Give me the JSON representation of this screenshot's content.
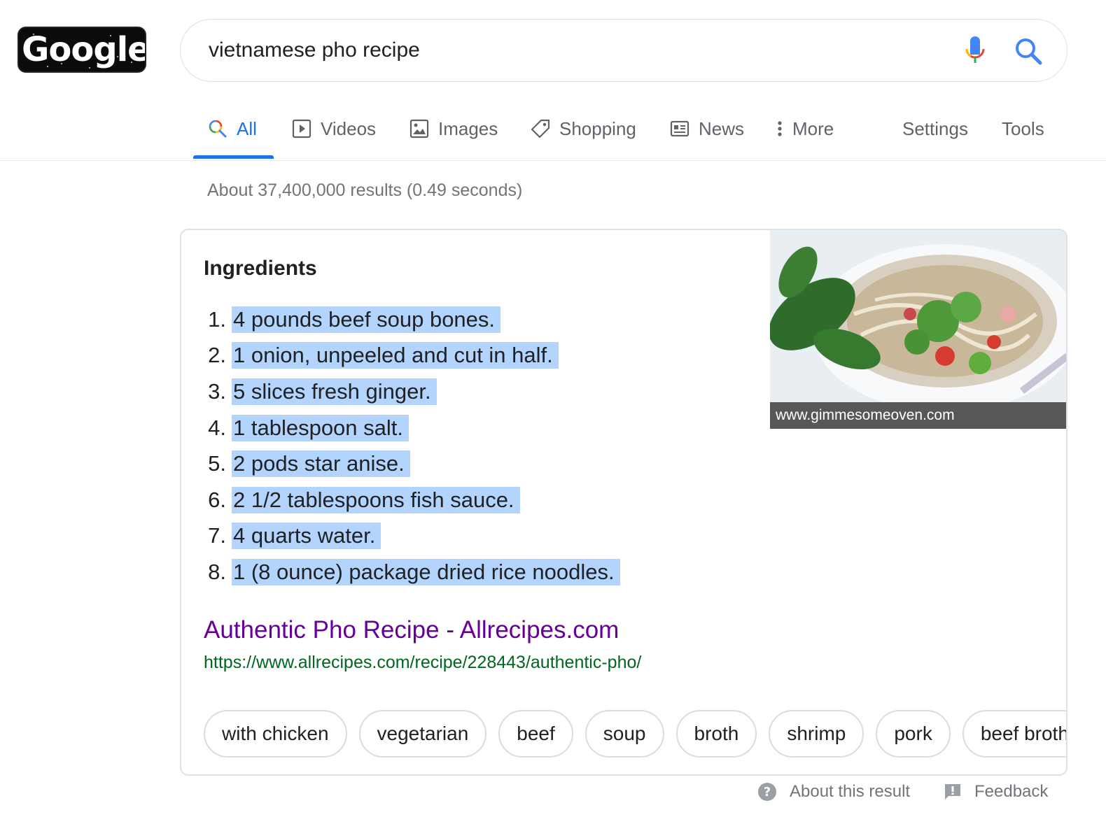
{
  "logo": {
    "text": "Google"
  },
  "search": {
    "query": "vietnamese pho recipe"
  },
  "tabs": [
    {
      "label": "All",
      "icon": "search-icon"
    },
    {
      "label": "Videos",
      "icon": "video-icon"
    },
    {
      "label": "Images",
      "icon": "image-icon"
    },
    {
      "label": "Shopping",
      "icon": "tag-icon"
    },
    {
      "label": "News",
      "icon": "news-icon"
    },
    {
      "label": "More",
      "icon": "more-vert-icon"
    }
  ],
  "tools": {
    "settings": "Settings",
    "tools": "Tools"
  },
  "stats": "About 37,400,000 results (0.49 seconds)",
  "card": {
    "heading": "Ingredients",
    "items": [
      {
        "num": "1.",
        "text": "4 pounds beef soup bones."
      },
      {
        "num": "2.",
        "text": "1 onion, unpeeled and cut in half."
      },
      {
        "num": "3.",
        "text": "5 slices fresh ginger."
      },
      {
        "num": "4.",
        "text": "1 tablespoon salt."
      },
      {
        "num": "5.",
        "text": "2 pods star anise."
      },
      {
        "num": "6.",
        "text": "2 1/2 tablespoons fish sauce."
      },
      {
        "num": "7.",
        "text": "4 quarts water."
      },
      {
        "num": "8.",
        "text": "1 (8 ounce) package dried rice noodles."
      }
    ],
    "image_caption": "www.gimmesomeoven.com",
    "result_title": "Authentic Pho Recipe - Allrecipes.com",
    "result_url": "https://www.allrecipes.com/recipe/228443/authentic-pho/",
    "chips": [
      "with chicken",
      "vegetarian",
      "beef",
      "soup",
      "broth",
      "shrimp",
      "pork",
      "beef broth"
    ]
  },
  "footer": {
    "about": "About this result",
    "feedback": "Feedback"
  },
  "colors": {
    "accent": "#1a73e8",
    "visited_link": "#660099",
    "url_green": "#006621",
    "highlight": "#b3d4fc"
  }
}
